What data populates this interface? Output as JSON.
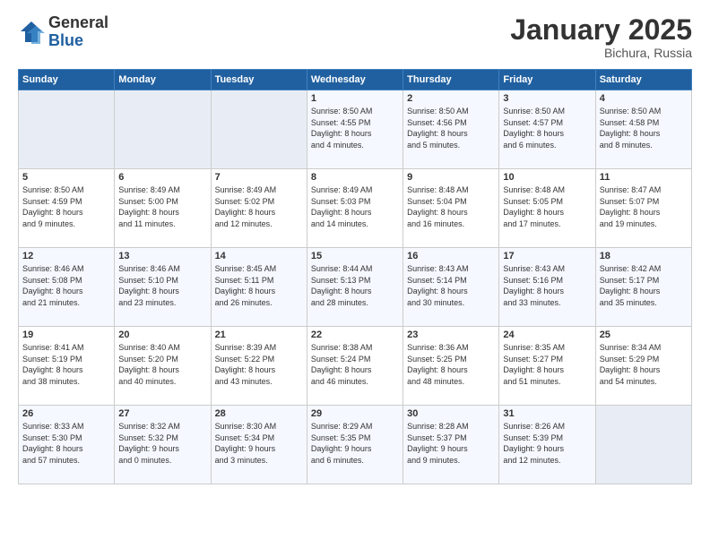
{
  "logo": {
    "general": "General",
    "blue": "Blue"
  },
  "title": "January 2025",
  "subtitle": "Bichura, Russia",
  "days_header": [
    "Sunday",
    "Monday",
    "Tuesday",
    "Wednesday",
    "Thursday",
    "Friday",
    "Saturday"
  ],
  "weeks": [
    [
      {
        "day": "",
        "info": ""
      },
      {
        "day": "",
        "info": ""
      },
      {
        "day": "",
        "info": ""
      },
      {
        "day": "1",
        "info": "Sunrise: 8:50 AM\nSunset: 4:55 PM\nDaylight: 8 hours\nand 4 minutes."
      },
      {
        "day": "2",
        "info": "Sunrise: 8:50 AM\nSunset: 4:56 PM\nDaylight: 8 hours\nand 5 minutes."
      },
      {
        "day": "3",
        "info": "Sunrise: 8:50 AM\nSunset: 4:57 PM\nDaylight: 8 hours\nand 6 minutes."
      },
      {
        "day": "4",
        "info": "Sunrise: 8:50 AM\nSunset: 4:58 PM\nDaylight: 8 hours\nand 8 minutes."
      }
    ],
    [
      {
        "day": "5",
        "info": "Sunrise: 8:50 AM\nSunset: 4:59 PM\nDaylight: 8 hours\nand 9 minutes."
      },
      {
        "day": "6",
        "info": "Sunrise: 8:49 AM\nSunset: 5:00 PM\nDaylight: 8 hours\nand 11 minutes."
      },
      {
        "day": "7",
        "info": "Sunrise: 8:49 AM\nSunset: 5:02 PM\nDaylight: 8 hours\nand 12 minutes."
      },
      {
        "day": "8",
        "info": "Sunrise: 8:49 AM\nSunset: 5:03 PM\nDaylight: 8 hours\nand 14 minutes."
      },
      {
        "day": "9",
        "info": "Sunrise: 8:48 AM\nSunset: 5:04 PM\nDaylight: 8 hours\nand 16 minutes."
      },
      {
        "day": "10",
        "info": "Sunrise: 8:48 AM\nSunset: 5:05 PM\nDaylight: 8 hours\nand 17 minutes."
      },
      {
        "day": "11",
        "info": "Sunrise: 8:47 AM\nSunset: 5:07 PM\nDaylight: 8 hours\nand 19 minutes."
      }
    ],
    [
      {
        "day": "12",
        "info": "Sunrise: 8:46 AM\nSunset: 5:08 PM\nDaylight: 8 hours\nand 21 minutes."
      },
      {
        "day": "13",
        "info": "Sunrise: 8:46 AM\nSunset: 5:10 PM\nDaylight: 8 hours\nand 23 minutes."
      },
      {
        "day": "14",
        "info": "Sunrise: 8:45 AM\nSunset: 5:11 PM\nDaylight: 8 hours\nand 26 minutes."
      },
      {
        "day": "15",
        "info": "Sunrise: 8:44 AM\nSunset: 5:13 PM\nDaylight: 8 hours\nand 28 minutes."
      },
      {
        "day": "16",
        "info": "Sunrise: 8:43 AM\nSunset: 5:14 PM\nDaylight: 8 hours\nand 30 minutes."
      },
      {
        "day": "17",
        "info": "Sunrise: 8:43 AM\nSunset: 5:16 PM\nDaylight: 8 hours\nand 33 minutes."
      },
      {
        "day": "18",
        "info": "Sunrise: 8:42 AM\nSunset: 5:17 PM\nDaylight: 8 hours\nand 35 minutes."
      }
    ],
    [
      {
        "day": "19",
        "info": "Sunrise: 8:41 AM\nSunset: 5:19 PM\nDaylight: 8 hours\nand 38 minutes."
      },
      {
        "day": "20",
        "info": "Sunrise: 8:40 AM\nSunset: 5:20 PM\nDaylight: 8 hours\nand 40 minutes."
      },
      {
        "day": "21",
        "info": "Sunrise: 8:39 AM\nSunset: 5:22 PM\nDaylight: 8 hours\nand 43 minutes."
      },
      {
        "day": "22",
        "info": "Sunrise: 8:38 AM\nSunset: 5:24 PM\nDaylight: 8 hours\nand 46 minutes."
      },
      {
        "day": "23",
        "info": "Sunrise: 8:36 AM\nSunset: 5:25 PM\nDaylight: 8 hours\nand 48 minutes."
      },
      {
        "day": "24",
        "info": "Sunrise: 8:35 AM\nSunset: 5:27 PM\nDaylight: 8 hours\nand 51 minutes."
      },
      {
        "day": "25",
        "info": "Sunrise: 8:34 AM\nSunset: 5:29 PM\nDaylight: 8 hours\nand 54 minutes."
      }
    ],
    [
      {
        "day": "26",
        "info": "Sunrise: 8:33 AM\nSunset: 5:30 PM\nDaylight: 8 hours\nand 57 minutes."
      },
      {
        "day": "27",
        "info": "Sunrise: 8:32 AM\nSunset: 5:32 PM\nDaylight: 9 hours\nand 0 minutes."
      },
      {
        "day": "28",
        "info": "Sunrise: 8:30 AM\nSunset: 5:34 PM\nDaylight: 9 hours\nand 3 minutes."
      },
      {
        "day": "29",
        "info": "Sunrise: 8:29 AM\nSunset: 5:35 PM\nDaylight: 9 hours\nand 6 minutes."
      },
      {
        "day": "30",
        "info": "Sunrise: 8:28 AM\nSunset: 5:37 PM\nDaylight: 9 hours\nand 9 minutes."
      },
      {
        "day": "31",
        "info": "Sunrise: 8:26 AM\nSunset: 5:39 PM\nDaylight: 9 hours\nand 12 minutes."
      },
      {
        "day": "",
        "info": ""
      }
    ]
  ]
}
